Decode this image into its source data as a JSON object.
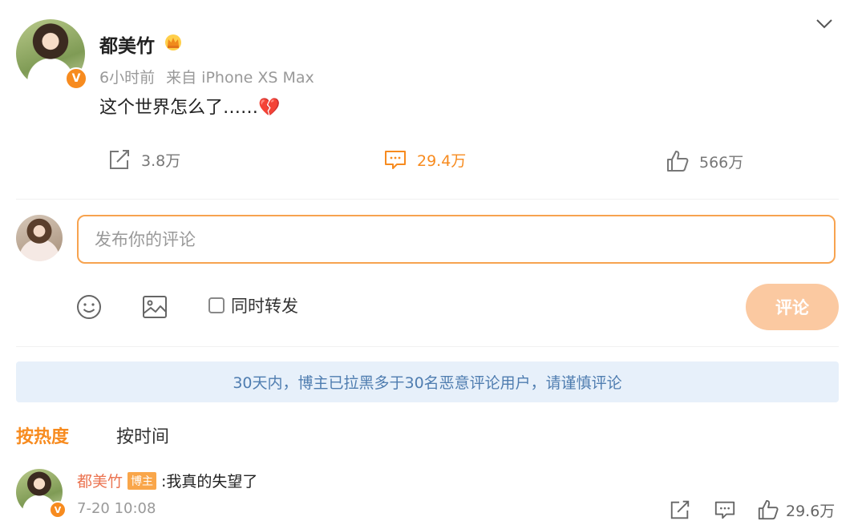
{
  "post": {
    "author": "都美竹",
    "time": "6小时前",
    "source": "来自 iPhone XS Max",
    "text": "这个世界怎么了……",
    "text_emoji": "💔",
    "verified_mark": "V",
    "icons": [
      "avatar",
      "verified-badge-icon",
      "crown-icon",
      "chevron-down-icon"
    ]
  },
  "actions": {
    "repost": "3.8万",
    "comment": "29.4万",
    "like": "566万"
  },
  "composer": {
    "placeholder": "发布你的评论",
    "value": "",
    "repost_label": "同时转发",
    "repost_checked": false,
    "submit_label": "评论",
    "icons": [
      "emoji-icon",
      "image-icon"
    ]
  },
  "notice": "30天内，博主已拉黑多于30名恶意评论用户，请谨慎评论",
  "sort": {
    "tabs": [
      {
        "label": "按热度",
        "active": true
      },
      {
        "label": "按时间",
        "active": false
      }
    ]
  },
  "comments": [
    {
      "author": "都美竹",
      "badge": "博主",
      "text": ":我真的失望了",
      "time": "7-20 10:08",
      "likes": "29.6万"
    }
  ],
  "colors": {
    "accent": "#f78b1f",
    "input_border": "#f7a34f",
    "submit_bg": "#fbc9a1",
    "notice_bg": "#e7f0fa",
    "notice_text": "#4f7db0",
    "comment_author": "#eb7350"
  }
}
